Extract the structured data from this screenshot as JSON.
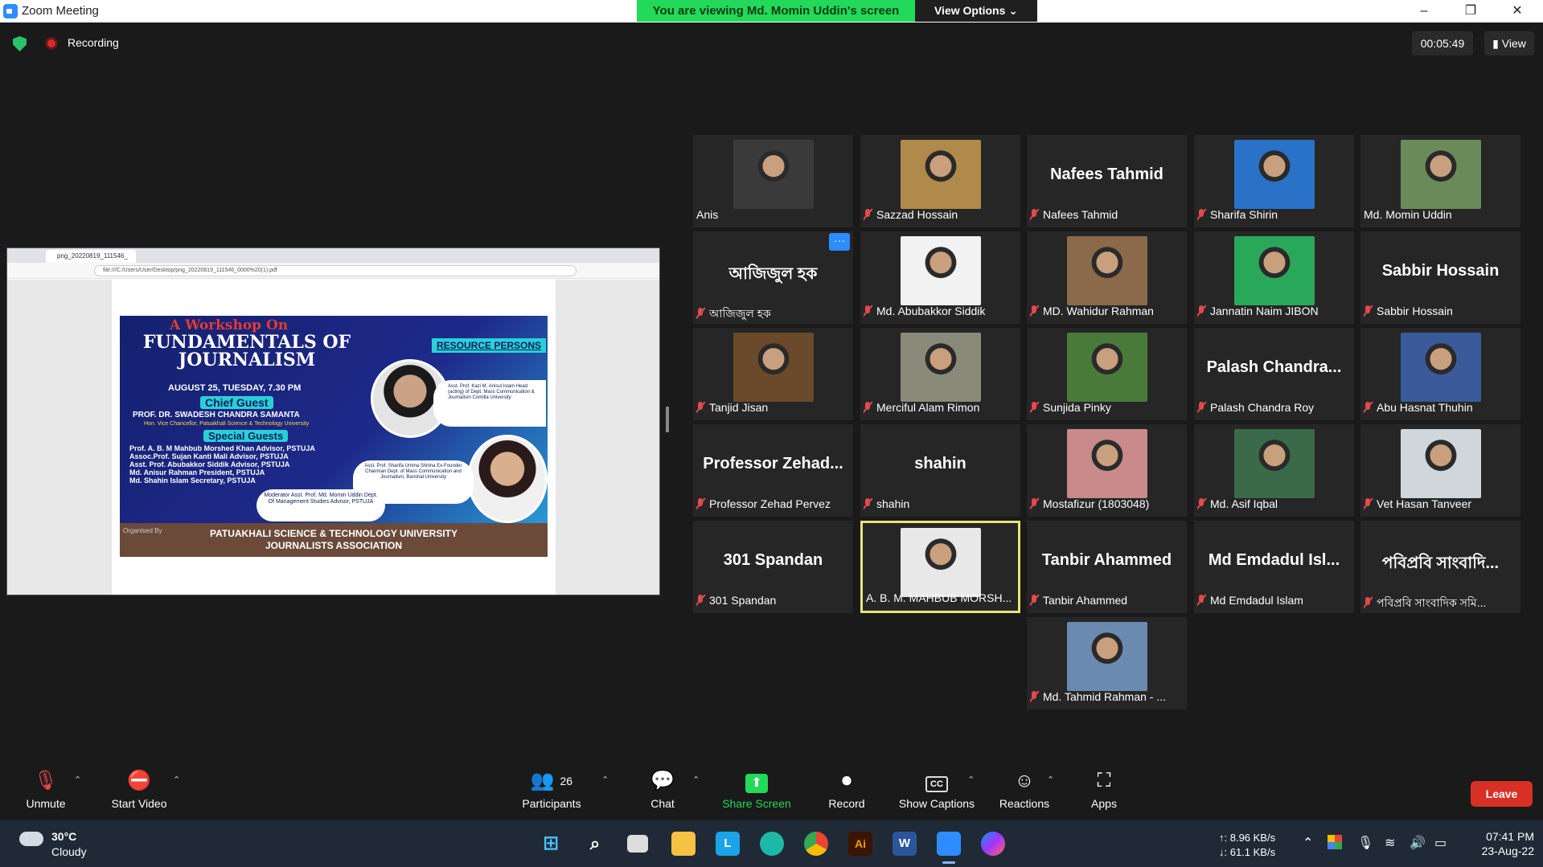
{
  "window": {
    "title": "Zoom Meeting",
    "minimize": "–",
    "restore": "❐",
    "close": "✕"
  },
  "banner": {
    "text": "You are viewing Md. Momin Uddin's screen",
    "view_options": "View Options ⌄"
  },
  "status": {
    "recording": "Recording",
    "timer": "00:05:49",
    "view": "View"
  },
  "shared_screen": {
    "tab_title": "png_20220819_111546_",
    "url": "file:///C:/Users/User/Desktop/png_20220819_111546_0000%20(1).pdf",
    "poster": {
      "heading1": "A Workshop On",
      "heading2": "FUNDAMENTALS OF JOURNALISM",
      "date": "AUGUST 25, TUESDAY, 7.30 PM",
      "chief_guest_label": "Chief Guest",
      "chief_guest": "PROF. DR. SWADESH CHANDRA SAMANTA",
      "chief_guest_role": "Hon. Vice Chancellor, Patuakhali Science & Technology University",
      "special_guests_label": "Special Guests",
      "special_guests": [
        "Prof. A. B. M Mahbub Morshed Khan  Advisor, PSTUJA",
        "Assoc.Prof. Sujan Kanti Mali  Advisor, PSTUJA",
        "Asst. Prof. Abubakkor Siddik  Advisor, PSTUJA",
        "Md. Anisur Rahman  President, PSTUJA",
        "Md. Shahin Islam  Secretary, PSTUJA"
      ],
      "resource_label": "RESOURCE PERSONS",
      "resource1": "Asst. Prof. Kazi M. Anisul Islam Head (acting) of Dept. Mass Communication & Journalism Comilla University",
      "resource2": "Asst. Prof. Sharifa Umma Shirina Ex-Founder Chairman Dept. of Mass Communication and Journalism, Barishal University",
      "moderator": "Moderator Asst. Prof. Md. Momin Uddin Dept. Of Management Studies Advisor, PSTUJA",
      "organised_by": "Organised By",
      "footer": "PATUAKHALI SCIENCE & TECHNOLOGY UNIVERSITY JOURNALISTS ASSOCIATION"
    }
  },
  "participants": [
    {
      "name": "Anis",
      "big": "",
      "muted": false,
      "photo": "#3a3a3a"
    },
    {
      "name": "Sazzad Hossain",
      "big": "",
      "muted": true,
      "photo": "#b08a4a"
    },
    {
      "name": "Nafees Tahmid",
      "big": "Nafees Tahmid",
      "muted": true,
      "photo": ""
    },
    {
      "name": "Sharifa Shirin",
      "big": "",
      "muted": true,
      "photo": "#2a72c8"
    },
    {
      "name": "Md. Momin Uddin",
      "big": "",
      "muted": false,
      "photo": "#6a8a5a"
    },
    {
      "name": "আজিজুল হক",
      "big": "আজিজুল হক",
      "muted": true,
      "photo": ""
    },
    {
      "name": "Md. Abubakkor Siddik",
      "big": "",
      "muted": true,
      "photo": "#f2f2f2"
    },
    {
      "name": "MD. Wahidur Rahman",
      "big": "",
      "muted": true,
      "photo": "#8a6a4a"
    },
    {
      "name": "Jannatin Naim JIBON",
      "big": "",
      "muted": true,
      "photo": "#2aa85a"
    },
    {
      "name": "Sabbir Hossain",
      "big": "Sabbir Hossain",
      "muted": true,
      "photo": ""
    },
    {
      "name": "Tanjid Jisan",
      "big": "",
      "muted": true,
      "photo": "#6a4a2a"
    },
    {
      "name": "Merciful Alam Rimon",
      "big": "",
      "muted": true,
      "photo": "#8a8a7a"
    },
    {
      "name": "Sunjida Pinky",
      "big": "",
      "muted": true,
      "photo": "#4a7a3a"
    },
    {
      "name": "Palash Chandra Roy",
      "big": "Palash Chandra...",
      "muted": true,
      "photo": ""
    },
    {
      "name": "Abu Hasnat Thuhin",
      "big": "",
      "muted": true,
      "photo": "#3a5a9a"
    },
    {
      "name": "Professor Zehad Pervez",
      "big": "Professor Zehad...",
      "muted": true,
      "photo": ""
    },
    {
      "name": "shahin",
      "big": "shahin",
      "muted": true,
      "photo": ""
    },
    {
      "name": "Mostafizur (1803048)",
      "big": "",
      "muted": true,
      "photo": "#c88a8a"
    },
    {
      "name": "Md. Asif Iqbal",
      "big": "",
      "muted": true,
      "photo": "#3a6a4a"
    },
    {
      "name": "Vet Hasan Tanveer",
      "big": "",
      "muted": true,
      "photo": "#cfd6dc"
    },
    {
      "name": "301 Spandan",
      "big": "301 Spandan",
      "muted": true,
      "photo": ""
    },
    {
      "name": "A. B. M. MAHBUB MORSH...",
      "big": "",
      "muted": false,
      "photo": "#e8e8e8",
      "active": true
    },
    {
      "name": "Tanbir Ahammed",
      "big": "Tanbir Ahammed",
      "muted": true,
      "photo": ""
    },
    {
      "name": "Md Emdadul Islam",
      "big": "Md Emdadul Isl...",
      "muted": true,
      "photo": ""
    },
    {
      "name": "পবিপ্রবি সাংবাদিক সমি...",
      "big": "পবিপ্রবি সাংবাদি...",
      "muted": true,
      "photo": ""
    },
    {
      "name": "Md. Tahmid Rahman - ...",
      "big": "",
      "muted": true,
      "photo": "#6a8ab0"
    }
  ],
  "toolbar": {
    "unmute": "Unmute",
    "start_video": "Start Video",
    "participants": "Participants",
    "participants_count": "26",
    "chat": "Chat",
    "share_screen": "Share Screen",
    "record": "Record",
    "show_captions": "Show Captions",
    "reactions": "Reactions",
    "apps": "Apps",
    "leave": "Leave"
  },
  "taskbar": {
    "temp": "30°C",
    "weather": "Cloudy",
    "upload": "↑: 8.96 KB/s",
    "download": "↓: 61.1 KB/s",
    "time": "07:41 PM",
    "date": "23-Aug-22"
  }
}
